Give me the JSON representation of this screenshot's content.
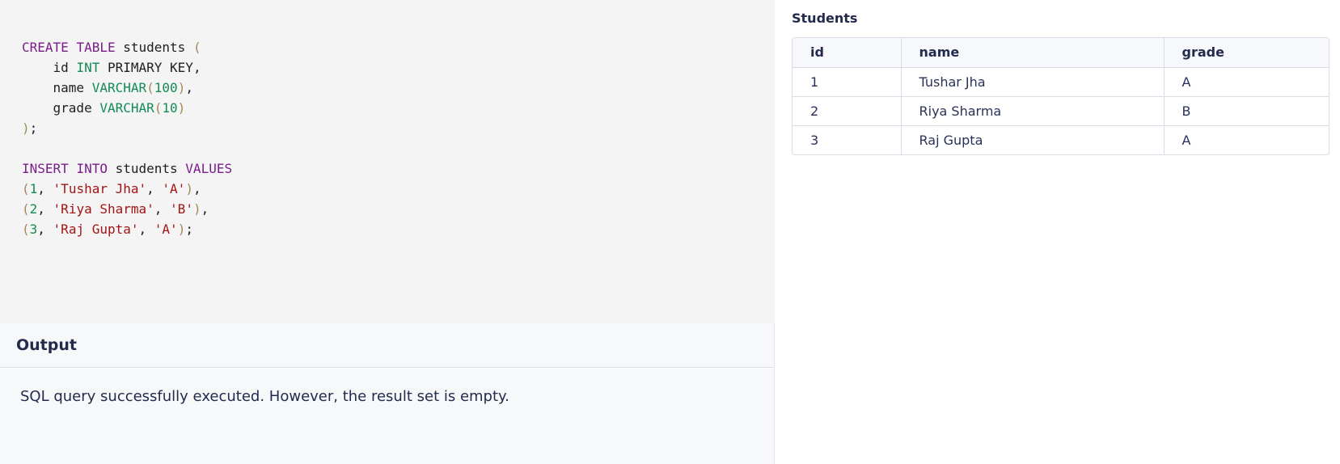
{
  "editor": {
    "code_lines": [
      [
        {
          "t": "CREATE",
          "c": "kw"
        },
        {
          "t": " ",
          "c": "txt"
        },
        {
          "t": "TABLE",
          "c": "kw"
        },
        {
          "t": " students ",
          "c": "txt"
        },
        {
          "t": "(",
          "c": "par"
        }
      ],
      [
        {
          "t": "    id ",
          "c": "txt"
        },
        {
          "t": "INT",
          "c": "typ"
        },
        {
          "t": " PRIMARY KEY,",
          "c": "txt"
        }
      ],
      [
        {
          "t": "    name ",
          "c": "txt"
        },
        {
          "t": "VARCHAR",
          "c": "typ"
        },
        {
          "t": "(",
          "c": "par"
        },
        {
          "t": "100",
          "c": "num"
        },
        {
          "t": ")",
          "c": "par"
        },
        {
          "t": ",",
          "c": "txt"
        }
      ],
      [
        {
          "t": "    grade ",
          "c": "txt"
        },
        {
          "t": "VARCHAR",
          "c": "typ"
        },
        {
          "t": "(",
          "c": "par"
        },
        {
          "t": "10",
          "c": "num"
        },
        {
          "t": ")",
          "c": "par"
        }
      ],
      [
        {
          "t": ")",
          "c": "par"
        },
        {
          "t": ";",
          "c": "txt"
        }
      ],
      [],
      [
        {
          "t": "INSERT",
          "c": "kw"
        },
        {
          "t": " ",
          "c": "txt"
        },
        {
          "t": "INTO",
          "c": "kw"
        },
        {
          "t": " students ",
          "c": "txt"
        },
        {
          "t": "VALUES",
          "c": "kw"
        }
      ],
      [
        {
          "t": "(",
          "c": "par"
        },
        {
          "t": "1",
          "c": "num"
        },
        {
          "t": ", ",
          "c": "txt"
        },
        {
          "t": "'Tushar Jha'",
          "c": "str"
        },
        {
          "t": ", ",
          "c": "txt"
        },
        {
          "t": "'A'",
          "c": "str"
        },
        {
          "t": ")",
          "c": "par"
        },
        {
          "t": ",",
          "c": "txt"
        }
      ],
      [
        {
          "t": "(",
          "c": "par"
        },
        {
          "t": "2",
          "c": "num"
        },
        {
          "t": ", ",
          "c": "txt"
        },
        {
          "t": "'Riya Sharma'",
          "c": "str"
        },
        {
          "t": ", ",
          "c": "txt"
        },
        {
          "t": "'B'",
          "c": "str"
        },
        {
          "t": ")",
          "c": "par"
        },
        {
          "t": ",",
          "c": "txt"
        }
      ],
      [
        {
          "t": "(",
          "c": "par"
        },
        {
          "t": "3",
          "c": "num"
        },
        {
          "t": ", ",
          "c": "txt"
        },
        {
          "t": "'Raj Gupta'",
          "c": "str"
        },
        {
          "t": ", ",
          "c": "txt"
        },
        {
          "t": "'A'",
          "c": "str"
        },
        {
          "t": ")",
          "c": "par"
        },
        {
          "t": ";",
          "c": "txt"
        }
      ]
    ],
    "colors": {
      "keyword": "#7a1d8a",
      "type": "#148a55",
      "string": "#a31515",
      "paren": "#a08a5a"
    }
  },
  "output": {
    "title": "Output",
    "message": "SQL query successfully executed. However, the result set is empty."
  },
  "table": {
    "title": "Students",
    "columns": [
      "id",
      "name",
      "grade"
    ],
    "rows": [
      [
        "1",
        "Tushar Jha",
        "A"
      ],
      [
        "2",
        "Riya Sharma",
        "B"
      ],
      [
        "3",
        "Raj Gupta",
        "A"
      ]
    ]
  }
}
